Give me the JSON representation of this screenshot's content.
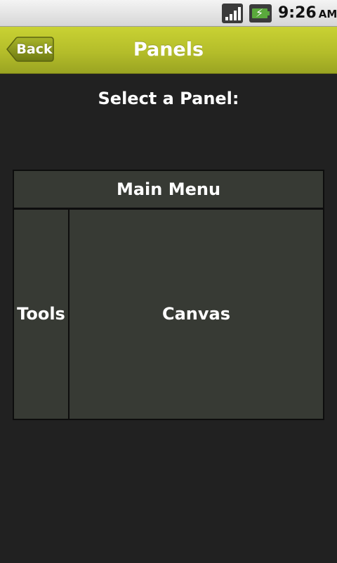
{
  "status_bar": {
    "time": "9:26",
    "ampm": "AM",
    "signal_icon": "signal-strength-icon",
    "battery_icon": "battery-charging-icon"
  },
  "title_bar": {
    "back_label": "Back",
    "title": "Panels",
    "accent_color": "#b4bd2a"
  },
  "prompt": "Select a Panel:",
  "panels": {
    "main_menu": "Main Menu",
    "tools": "Tools",
    "canvas": "Canvas"
  }
}
